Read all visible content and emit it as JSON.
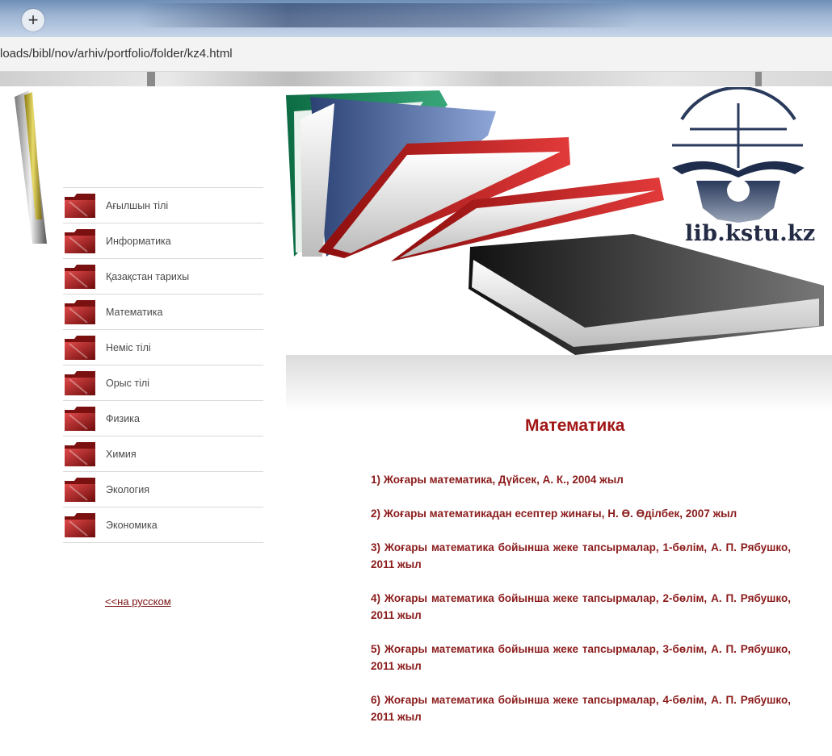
{
  "browser": {
    "new_tab": "+",
    "url": "loads/bibl/nov/arhiv/portfolio/folder/kz4.html"
  },
  "site": {
    "name": "lib.kstu.kz"
  },
  "sidebar": {
    "items": [
      {
        "label": "Ағылшын тілі"
      },
      {
        "label": "Информатика"
      },
      {
        "label": "Қазақстан тарихы"
      },
      {
        "label": "Математика"
      },
      {
        "label": "Неміс тілі"
      },
      {
        "label": "Орыс тілі"
      },
      {
        "label": "Физика"
      },
      {
        "label": "Химия"
      },
      {
        "label": "Экология"
      },
      {
        "label": "Экономика"
      }
    ],
    "lang_link": "<<на русском"
  },
  "main": {
    "title": "Математика",
    "books": [
      "1) Жоғары математика, Дүйсек, А. К., 2004 жыл",
      "2) Жоғары математикадан есептер жинағы, Н. Ө. Өділбек, 2007 жыл",
      "3) Жоғары математика бойынша жеке тапсырмалар, 1-бөлім, А. П. Рябушко, 2011 жыл",
      "4) Жоғары математика бойынша жеке тапсырмалар, 2-бөлім, А. П. Рябушко, 2011 жыл",
      "5) Жоғары математика бойынша жеке тапсырмалар, 3-бөлім, А. П. Рябушко, 2011 жыл",
      "6) Жоғары математика бойынша жеке тапсырмалар, 4-бөлім, А. П. Рябушко, 2011 жыл"
    ]
  },
  "colors": {
    "accent": "#a11616",
    "book_text": "#8b1b1b",
    "link": "#7a1010"
  }
}
